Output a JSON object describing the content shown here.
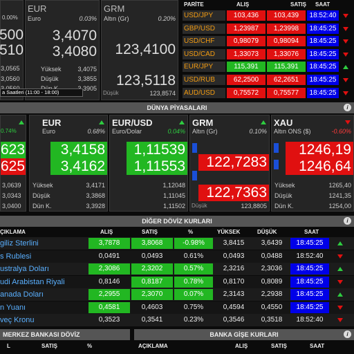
{
  "top": {
    "t0": {
      "pct": "0.00%",
      "v1": "500",
      "v2": "510",
      "r1": "3,0565",
      "r2": "3,0560",
      "r3": "3,0560"
    },
    "eur": {
      "code": "EUR",
      "name": "Euro",
      "pct": "0.03%",
      "buy": "3,4070",
      "sell": "3,4080",
      "high_l": "Yüksek",
      "high": "3,4075",
      "low_l": "Düşük",
      "low": "3,3855",
      "close_l": "Dün K.",
      "close": "3,3905"
    },
    "grm": {
      "code": "GRM",
      "name": "Altın (Gr)",
      "pct": "0.20%",
      "buy": "123,4100",
      "sell": "123,5118",
      "low_l": "Düşük",
      "low": "123,8574"
    },
    "note": "a Saatleri (11:00 - 18:00)"
  },
  "parite": {
    "headers": [
      "PARİTE",
      "ALIŞ",
      "SATIŞ",
      "SAAT"
    ],
    "rows": [
      {
        "name": "USD/JPY",
        "buy": "103,436",
        "sell": "103,439",
        "time": "18:52:40",
        "dir": "down"
      },
      {
        "name": "GBP/USD",
        "buy": "1,23987",
        "sell": "1,23998",
        "time": "18:45:25",
        "dir": "down"
      },
      {
        "name": "USD/CHF",
        "buy": "0,98079",
        "sell": "0,98094",
        "time": "18:45:25",
        "dir": "down"
      },
      {
        "name": "USD/CAD",
        "buy": "1,33073",
        "sell": "1,33076",
        "time": "18:45:25",
        "dir": "down"
      },
      {
        "name": "EUR/JPY",
        "buy": "115,391",
        "sell": "115,391",
        "time": "18:45:25",
        "dir": "up"
      },
      {
        "name": "USD/RUB",
        "buy": "62,2500",
        "sell": "62,2651",
        "time": "18:45:25",
        "dir": "down"
      },
      {
        "name": "AUD/USD",
        "buy": "0,75572",
        "sell": "0,75577",
        "time": "18:45:25",
        "dir": "down"
      }
    ]
  },
  "dunya": {
    "title": "DÜNYA PİYASALARI",
    "c0": {
      "pct": "0.74%",
      "buy": "623",
      "sell": "625",
      "r1": "3,0639",
      "r2": "3,0343",
      "r3": "3,0400"
    },
    "eur": {
      "code": "EUR",
      "name": "Euro",
      "pct": "0.68%",
      "buy": "3,4158",
      "sell": "3,4162",
      "high_l": "Yüksek",
      "high": "3,4171",
      "low_l": "Düşük",
      "low": "3,3868",
      "close_l": "Dün K.",
      "close": "3,3928"
    },
    "eurusd": {
      "code": "EUR/USD",
      "name": "Euro/Dolar",
      "pct": "0.04%",
      "buy": "1,11539",
      "sell": "1,11553",
      "high": "1,12048",
      "low": "1,11045",
      "close": "1,11502"
    },
    "grm": {
      "code": "GRM",
      "name": "Altın (Gr)",
      "pct": "0.10%",
      "buy": "122,7283",
      "sell": "122,7363",
      "low_l": "Düşük",
      "low": "123,8805"
    },
    "xau": {
      "code": "XAU",
      "name": "Altın ONS ($)",
      "pct": "-0.60%",
      "buy": "1246,19",
      "sell": "1246,64",
      "high_l": "Yüksek",
      "high": "1265,40",
      "low_l": "Düşük",
      "low": "1241,35",
      "close_l": "Dün K.",
      "close": "1254,00"
    }
  },
  "diger": {
    "title": "DİĞER DÖVİZ KURLARI",
    "headers": [
      "ÇIKLAMA",
      "ALIŞ",
      "SATIŞ",
      "%",
      "YÜKSEK",
      "DÜŞÜK",
      "SAAT"
    ],
    "rows": [
      {
        "name": "giliz Sterlini",
        "buy": "3,7878",
        "sell": "3,8068",
        "pct": "-0.98%",
        "high": "3,8415",
        "low": "3,6439",
        "time": "18:45:25",
        "dir": "up",
        "bb": "g",
        "sb": "g",
        "pb": "g",
        "tb": "bl"
      },
      {
        "name": "s Rublesi",
        "buy": "0,0491",
        "sell": "0,0493",
        "pct": "0.61%",
        "high": "0,0493",
        "low": "0,0488",
        "time": "18:52:40",
        "dir": "down",
        "bb": "",
        "sb": "",
        "pb": "",
        "tb": ""
      },
      {
        "name": "ustralya Doları",
        "buy": "2,3086",
        "sell": "2,3202",
        "pct": "0.57%",
        "high": "2,3216",
        "low": "2,3036",
        "time": "18:45:25",
        "dir": "up",
        "bb": "g",
        "sb": "g",
        "pb": "g",
        "tb": "bl"
      },
      {
        "name": "udi Arabistan Riyali",
        "buy": "0,8146",
        "sell": "0,8187",
        "pct": "0.78%",
        "high": "0,8170",
        "low": "0,8089",
        "time": "18:45:25",
        "dir": "down",
        "bb": "",
        "sb": "g",
        "pb": "g",
        "tb": "bl"
      },
      {
        "name": "anada Doları",
        "buy": "2,2955",
        "sell": "2,3070",
        "pct": "0.07%",
        "high": "2,3143",
        "low": "2,2938",
        "time": "18:45:25",
        "dir": "up",
        "bb": "g",
        "sb": "g",
        "pb": "g",
        "tb": "bl"
      },
      {
        "name": "n Yuanı",
        "buy": "0,4581",
        "sell": "0,4603",
        "pct": "0.75%",
        "high": "0,4594",
        "low": "0,4550",
        "time": "18:45:25",
        "dir": "down",
        "bb": "g",
        "sb": "",
        "pb": "",
        "tb": "bl"
      },
      {
        "name": "veç Kronu",
        "buy": "0,3523",
        "sell": "0,3541",
        "pct": "0.23%",
        "high": "0,3546",
        "low": "0,3518",
        "time": "18:52:40",
        "dir": "down",
        "bb": "",
        "sb": "",
        "pb": "",
        "tb": ""
      }
    ]
  },
  "merkez": {
    "title": "MERKEZ BANKASI DÖVİZ",
    "headers": [
      "L",
      "SATIŞ",
      "%"
    ]
  },
  "banka": {
    "title": "BANKA GİŞE KURLARI",
    "headers": [
      "AÇIKLAMA",
      "ALIŞ",
      "SATIŞ",
      "SAAT"
    ]
  },
  "colors": {
    "up": "#2ecc40",
    "down": "#e01010",
    "time_bg": "#0000e8",
    "buy_bg": "#22b722"
  }
}
